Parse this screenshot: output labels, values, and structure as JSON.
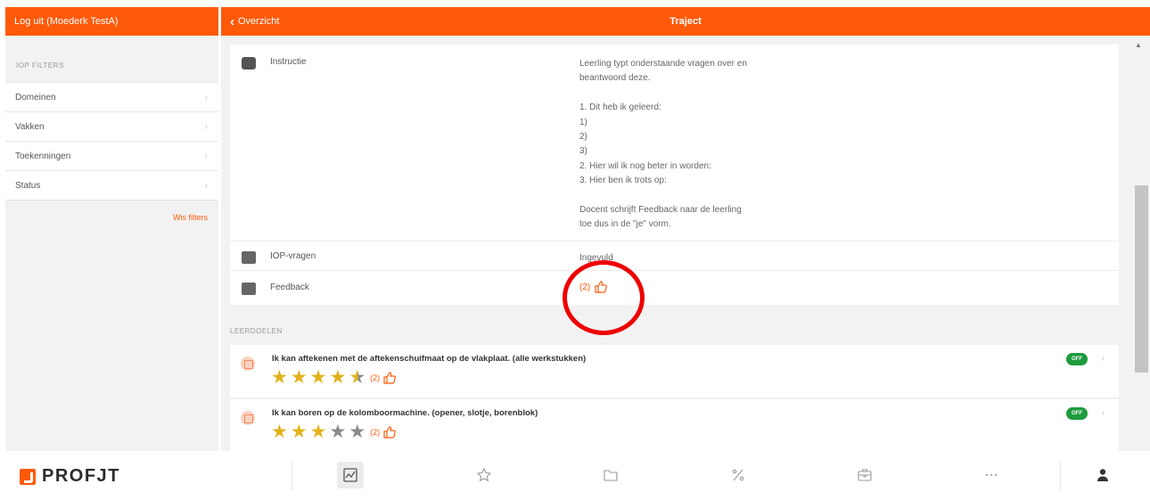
{
  "header": {
    "logout_label": "Log uit (Moederk TestA)",
    "back_label": "Overzicht",
    "page_title": "Traject"
  },
  "sidebar": {
    "section_title": "IOP FILTERS",
    "items": [
      {
        "label": "Domeinen"
      },
      {
        "label": "Vakken"
      },
      {
        "label": "Toekenningen"
      },
      {
        "label": "Status"
      }
    ],
    "clear_label": "Wis filters"
  },
  "details": {
    "instructie": {
      "label": "Instructie",
      "value": "Leerling typt onderstaande vragen over en\nbeantwoord deze.\n\n1. Dit heb ik geleerd:\n1)\n2)\n3)\n2. Hier wil ik nog beter in worden:\n3. Hier ben ik trots op:\n\nDocent schrijft Feedback naar de leerling\ntoe dus in de \"je\" vorm."
    },
    "iop_vragen": {
      "label": "IOP-vragen",
      "value": "Ingevuld"
    },
    "feedback": {
      "label": "Feedback",
      "count": "(2)"
    }
  },
  "goals_section": {
    "title": "LEERDOELEN",
    "goals": [
      {
        "title": "Ik kan aftekenen met de aftekenschuifmaat op de vlakplaat. (alle werkstukken)",
        "rating": 4.5,
        "count": "(2)",
        "toggle": "OFF"
      },
      {
        "title": "Ik kan boren op de kolomboormachine. (opener, slotje, borenblok)",
        "rating": 3,
        "count": "(2)",
        "toggle": "OFF"
      }
    ]
  },
  "brand": {
    "name": "PROFJT",
    "accent": "#ff5a0a"
  },
  "bottom_nav": {
    "items": [
      "chart-icon",
      "star-icon",
      "folder-icon",
      "percent-icon",
      "briefcase-icon",
      "more-icon",
      "user-icon"
    ],
    "active": "chart-icon"
  },
  "colors": {
    "orange": "#ff5a0a",
    "star": "#e2b21b",
    "toggle_green": "#1e9a3e",
    "highlight_circle": "#ee0000"
  }
}
